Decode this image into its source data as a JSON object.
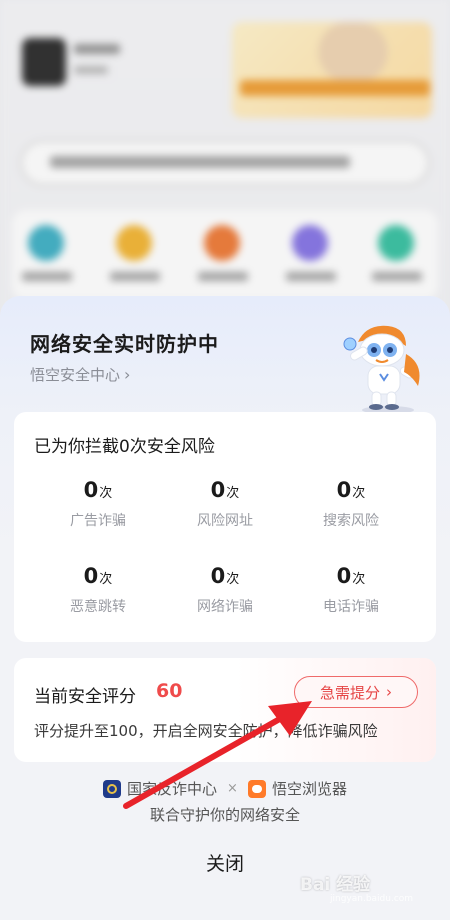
{
  "sheet": {
    "title": "网络安全实时防护中",
    "link_label": "悟空安全中心",
    "link_chevron": "›"
  },
  "intercept": {
    "title": "已为你拦截0次安全风险",
    "unit": "次",
    "stats": [
      {
        "value": "0",
        "label": "广告诈骗"
      },
      {
        "value": "0",
        "label": "风险网址"
      },
      {
        "value": "0",
        "label": "搜索风险"
      },
      {
        "value": "0",
        "label": "恶意跳转"
      },
      {
        "value": "0",
        "label": "网络诈骗"
      },
      {
        "value": "0",
        "label": "电话诈骗"
      }
    ]
  },
  "score": {
    "title": "当前安全评分",
    "value": "60",
    "button_label": "急需提分",
    "button_chevron": "›",
    "description": "评分提升至100，开启全网安全防护，降低诈骗风险"
  },
  "footer": {
    "partner1": "国家反诈中心",
    "times": "×",
    "partner2": "悟空浏览器",
    "tagline": "联合守护你的网络安全",
    "close_label": "关闭"
  },
  "watermark": {
    "text": "Bai 经验",
    "sub": "jingyan.baidu.com"
  },
  "colors": {
    "accent_red": "#ef4b4b",
    "arrow_red": "#e8232a",
    "sheet_top": "#e6ecfb"
  }
}
